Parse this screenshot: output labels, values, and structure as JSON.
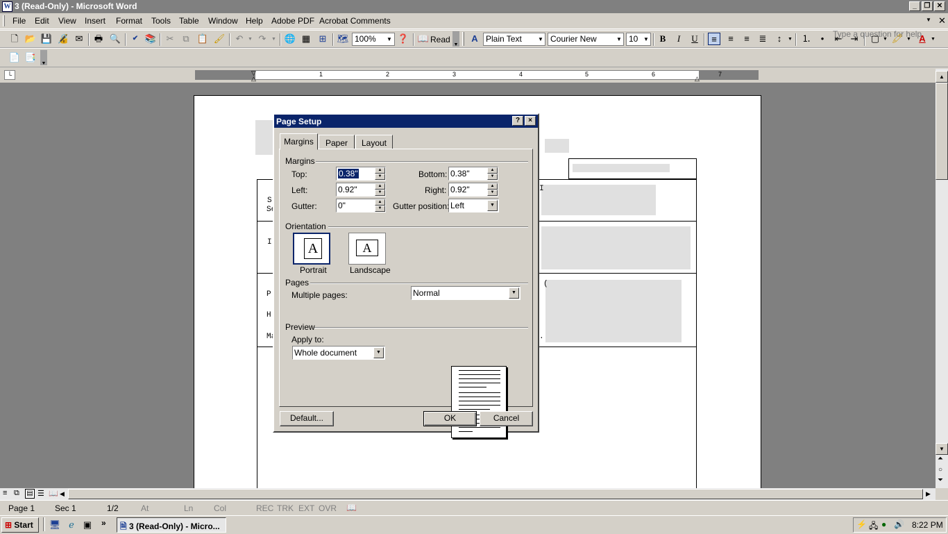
{
  "window": {
    "title": "3 (Read-Only) - Microsoft Word"
  },
  "menu": {
    "items": [
      "File",
      "Edit",
      "View",
      "Insert",
      "Format",
      "Tools",
      "Table",
      "Window",
      "Help",
      "Adobe PDF",
      "Acrobat Comments"
    ],
    "help_placeholder": "Type a question for help"
  },
  "toolbar": {
    "zoom": "100%",
    "read_label": "Read",
    "style": "Plain Text",
    "font": "Courier New",
    "size": "10",
    "bold": "B",
    "italic": "I",
    "underline": "U"
  },
  "ruler": {
    "numbers": [
      "1",
      "2",
      "3",
      "4",
      "5",
      "6",
      "7"
    ]
  },
  "dialog": {
    "title": "Page Setup",
    "help_button": "?",
    "close_button": "×",
    "tabs": [
      "Margins",
      "Paper",
      "Layout"
    ],
    "margins_group": "Margins",
    "top_label": "Top:",
    "top_value": "0.38\"",
    "bottom_label": "Bottom:",
    "bottom_value": "0.38\"",
    "left_label": "Left:",
    "left_value": "0.92\"",
    "right_label": "Right:",
    "right_value": "0.92\"",
    "gutter_label": "Gutter:",
    "gutter_value": "0\"",
    "gutter_position_label": "Gutter position:",
    "gutter_position_value": "Left",
    "orientation_group": "Orientation",
    "portrait_label": "Portrait",
    "landscape_label": "Landscape",
    "orientation_glyph": "A",
    "pages_group": "Pages",
    "multiple_pages_label": "Multiple pages:",
    "multiple_pages_value": "Normal",
    "preview_group": "Preview",
    "apply_to_label": "Apply to:",
    "apply_to_value": "Whole document",
    "default_button": "Default...",
    "ok_button": "OK",
    "cancel_button": "Cancel"
  },
  "document": {
    "fragments": [
      "S",
      "Se",
      "I",
      "P:",
      "H",
      "Ma",
      "I",
      ".",
      "("
    ]
  },
  "status": {
    "page": "Page 1",
    "sec": "Sec 1",
    "pages": "1/2",
    "at": "At",
    "ln": "Ln",
    "col": "Col",
    "rec": "REC",
    "trk": "TRK",
    "ext": "EXT",
    "ovr": "OVR"
  },
  "taskbar": {
    "start": "Start",
    "task": "3 (Read-Only) - Micro...",
    "clock": "8:22 PM"
  }
}
